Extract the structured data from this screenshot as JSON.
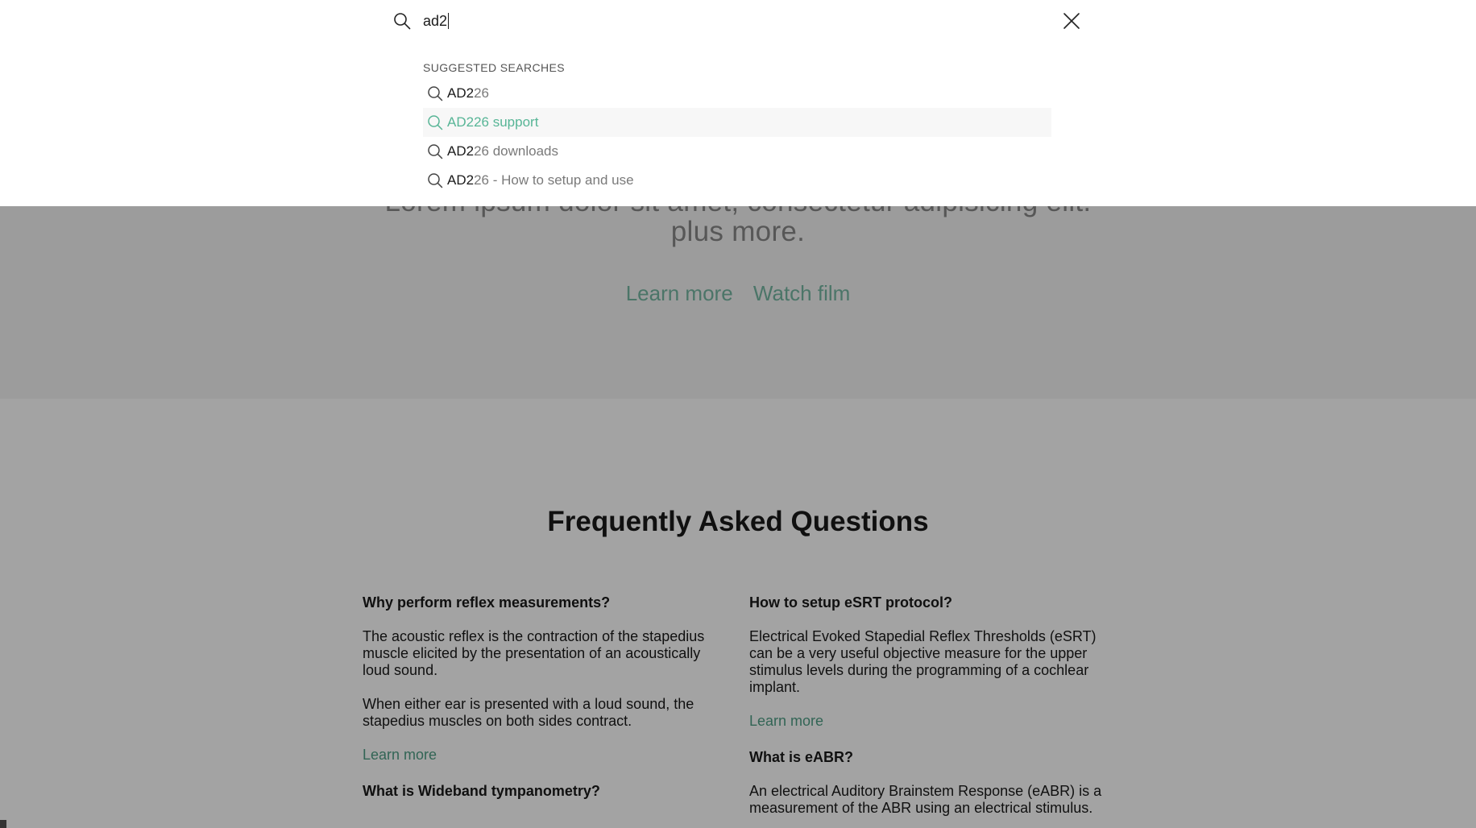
{
  "hero": {
    "text_line1": "Lorem ipsum dolor sit amet, consectetur adipisicing elit.",
    "text_line2": "plus more.",
    "link_learn_more": "Learn more",
    "link_watch_film": "Watch film"
  },
  "faq": {
    "title": "Frequently Asked Questions",
    "left": [
      {
        "question": "Why perform reflex measurements?",
        "paragraphs": [
          "The acoustic reflex is the contraction of the stapedius muscle elicited by the presentation of an acoustically loud sound.",
          "When either ear is presented with a loud sound, the stapedius muscles on both sides contract."
        ],
        "link": "Learn more"
      },
      {
        "question": "What is Wideband tympanometry?"
      }
    ],
    "right": [
      {
        "question": "How to setup eSRT protocol?",
        "paragraphs": [
          "Electrical Evoked Stapedial Reflex Thresholds (eSRT) can be a very useful objective measure for the upper stimulus levels during the programming of a cochlear implant."
        ],
        "link": "Learn more"
      },
      {
        "question": "What is eABR?",
        "paragraphs": [
          "An electrical Auditory Brainstem Response (eABR) is a measurement of the ABR using an electrical stimulus."
        ]
      }
    ]
  },
  "search": {
    "value": "ad2",
    "search_icon": "search-icon",
    "close_icon": "close-icon",
    "suggested_heading": "SUGGESTED SEARCHES",
    "suggestions": [
      {
        "match": "AD2",
        "rest": "26"
      },
      {
        "match": "AD2",
        "rest": "26 support"
      },
      {
        "match": "AD2",
        "rest": "26 downloads"
      },
      {
        "match": "AD2",
        "rest": "26 - How to setup and use"
      }
    ],
    "active_index": 1
  },
  "colors": {
    "accent": "#57b596",
    "link": "#4f9e86",
    "overlay": "rgba(0,0,0,0.36)"
  }
}
